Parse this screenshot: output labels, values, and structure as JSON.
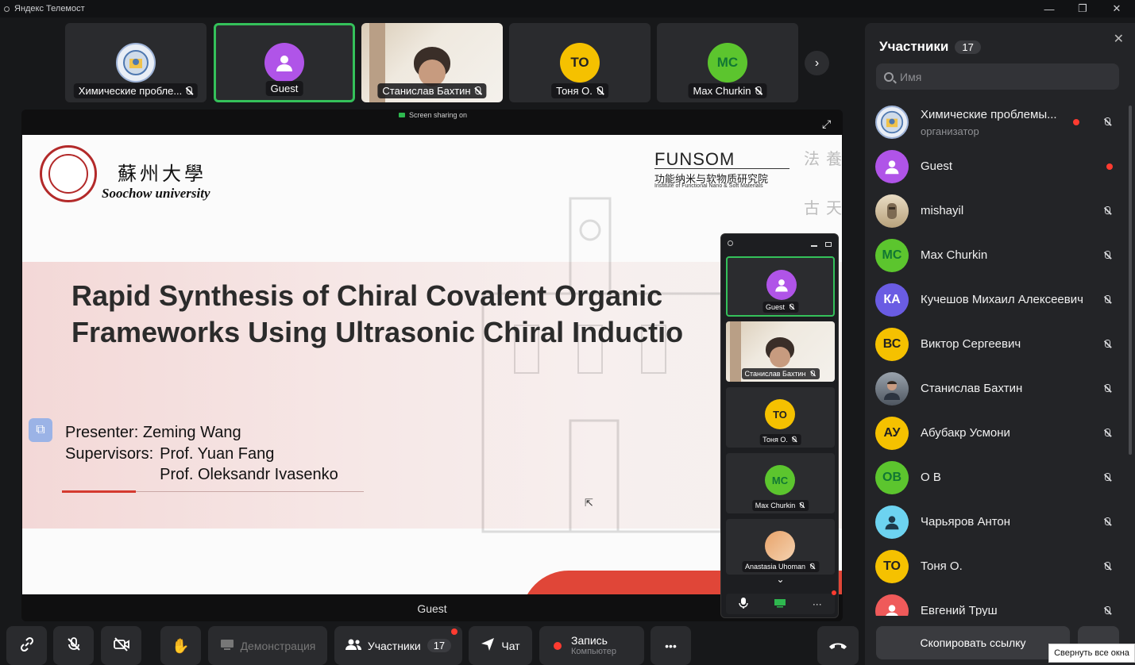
{
  "window": {
    "title": "Яндекс Телемост",
    "minimize": "—",
    "restore": "❐",
    "close": "✕"
  },
  "tiles": [
    {
      "name": "Химические пробле...",
      "type": "logo"
    },
    {
      "name": "Guest",
      "type": "avatar",
      "color": "#b054e8"
    },
    {
      "name": "Станислав Бахтин",
      "type": "photo"
    },
    {
      "name": "Тоня О.",
      "type": "initials",
      "initials": "ТО",
      "color": "#f5c100"
    },
    {
      "name": "Max Churkin",
      "type": "initials",
      "initials": "MC",
      "color": "#5cc52e"
    }
  ],
  "next_icon": "›",
  "share": {
    "banner": "Screen sharing on",
    "presenter_name": "Guest",
    "expand_icon": "⤢"
  },
  "slide": {
    "university_cn": "蘇州大學",
    "university_en": "Soochow university",
    "funsom": "FUNSOM",
    "funsom_cn": "功能纳米与软物质研究院",
    "funsom_en": "Institute of Functional Nano & Soft Materials",
    "callig_1": "法",
    "callig_2": "養",
    "callig_3": "古",
    "callig_4": "天",
    "title_line1": "Rapid Synthesis of Chiral Covalent Organic",
    "title_line2": "Frameworks Using Ultrasonic Chiral Inductio",
    "presenter": "Presenter: Zeming Wang",
    "supervisors_label": "Supervisors:",
    "supervisor1": "Prof. Yuan Fang",
    "supervisor2": "Prof. Oleksandr Ivasenko"
  },
  "float_panel": {
    "tiles": [
      {
        "name": "Guest",
        "color": "#b054e8"
      },
      {
        "name": "Станислав Бахтин"
      },
      {
        "name": "Тоня О.",
        "initials": "ТО",
        "color": "#f5c100"
      },
      {
        "name": "Max Churkin",
        "initials": "MC",
        "color": "#5cc52e"
      },
      {
        "name": "Anastasia Uhoman"
      }
    ],
    "chevron": "⌄",
    "more": "···"
  },
  "toolbar": {
    "demo_label": "Демонстрация",
    "participants_label": "Участники",
    "participants_count": "17",
    "chat_label": "Чат",
    "record_label": "Запись",
    "record_sub": "Компьютер",
    "more_label": "•••"
  },
  "panel": {
    "title": "Участники",
    "count": "17",
    "close_icon": "✕",
    "search_placeholder": "Имя",
    "participants": [
      {
        "name": "Химические проблемы...",
        "role": "организатор",
        "type": "logo",
        "live": true
      },
      {
        "name": "Guest",
        "type": "avatar",
        "color": "#b054e8",
        "live": true
      },
      {
        "name": "mishayil",
        "type": "photo"
      },
      {
        "name": "Max Churkin",
        "initials": "MC",
        "color": "#5cc52e"
      },
      {
        "name": "Кучешов Михаил Алексеевич",
        "initials": "КА",
        "color": "#6a5ce3"
      },
      {
        "name": "Виктор Сергеевич",
        "initials": "ВС",
        "color": "#f5c100"
      },
      {
        "name": "Станислав Бахтин",
        "type": "photo"
      },
      {
        "name": "Абубакр Усмони",
        "initials": "АУ",
        "color": "#f5c100"
      },
      {
        "name": "О В",
        "initials": "ОВ",
        "color": "#5cc52e"
      },
      {
        "name": "Чарьяров Антон",
        "type": "avatar",
        "color": "#6dd3f0"
      },
      {
        "name": "Тоня О.",
        "initials": "ТО",
        "color": "#f5c100"
      },
      {
        "name": "Евгений Труш",
        "type": "avatar",
        "color": "#ef5a5a"
      }
    ],
    "copy_link": "Скопировать ссылку",
    "tooltip": "Свернуть все окна"
  }
}
